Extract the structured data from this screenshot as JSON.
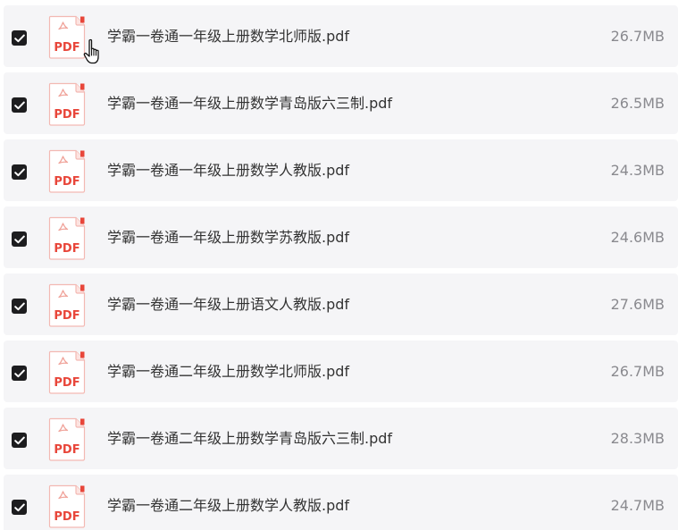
{
  "colors": {
    "row_background": "#f5f5f7",
    "checkbox": "#1d1d1f",
    "pdf_red": "#e8463a",
    "pdf_border": "#f3b9b3",
    "text": "#333333",
    "size_text": "#8a8a8f"
  },
  "icons": {
    "checkbox": "check-icon",
    "file": "pdf-file-icon",
    "pointer": "hand-pointer-icon"
  },
  "pdf_badge": "PDF",
  "files": [
    {
      "name": "学霸一卷通一年级上册数学北师版.pdf",
      "size": "26.7MB",
      "checked": true
    },
    {
      "name": "学霸一卷通一年级上册数学青岛版六三制.pdf",
      "size": "26.5MB",
      "checked": true
    },
    {
      "name": "学霸一卷通一年级上册数学人教版.pdf",
      "size": "24.3MB",
      "checked": true
    },
    {
      "name": "学霸一卷通一年级上册数学苏教版.pdf",
      "size": "24.6MB",
      "checked": true
    },
    {
      "name": "学霸一卷通一年级上册语文人教版.pdf",
      "size": "27.6MB",
      "checked": true
    },
    {
      "name": "学霸一卷通二年级上册数学北师版.pdf",
      "size": "26.7MB",
      "checked": true
    },
    {
      "name": "学霸一卷通二年级上册数学青岛版六三制.pdf",
      "size": "28.3MB",
      "checked": true
    },
    {
      "name": "学霸一卷通二年级上册数学人教版.pdf",
      "size": "24.7MB",
      "checked": true
    }
  ]
}
